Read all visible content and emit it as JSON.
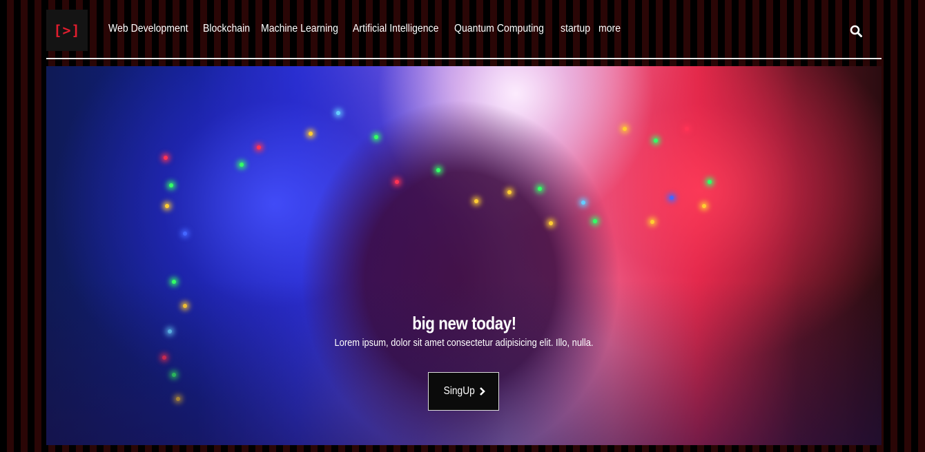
{
  "header": {
    "logo_text": "[>]",
    "nav": [
      {
        "label": "Web Development"
      },
      {
        "label": "Blockchain"
      },
      {
        "label": "Machine Learning"
      },
      {
        "label": "Artificial Intelligence"
      },
      {
        "label": "Quantum Computing"
      },
      {
        "label": "startup"
      },
      {
        "label": "more"
      }
    ],
    "search_icon": "search-icon"
  },
  "hero": {
    "title": "big new today!",
    "text": "Lorem ipsum, dolor sit amet consectetur adipisicing elit. Illo, nulla.",
    "button_label": "SingUp",
    "button_icon": "chevron-right-icon"
  },
  "colors": {
    "logo_accent": "#e11d2e",
    "stripe_dark": "#000000",
    "stripe_red": "#2a0606"
  }
}
